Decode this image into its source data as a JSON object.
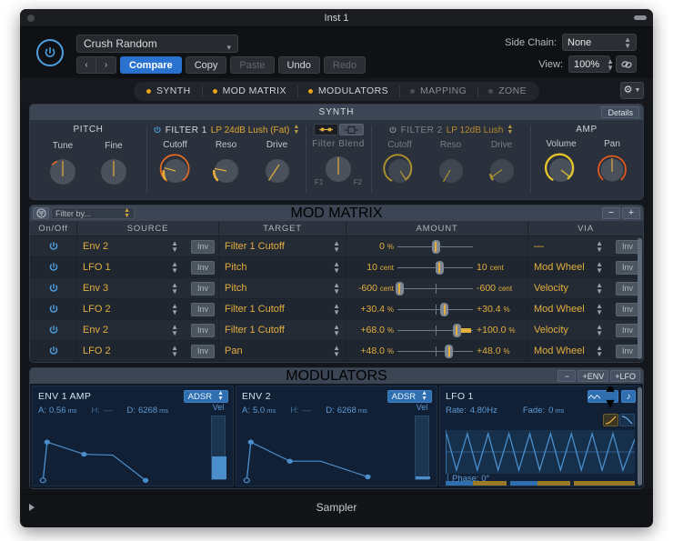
{
  "window": {
    "title": "Inst 1"
  },
  "header": {
    "preset": "Crush Random",
    "prev": "‹",
    "next": "›",
    "compare": "Compare",
    "copy": "Copy",
    "paste": "Paste",
    "undo": "Undo",
    "redo": "Redo",
    "side_chain_label": "Side Chain:",
    "side_chain_value": "None",
    "view_label": "View:",
    "view_value": "100%"
  },
  "tabs": [
    {
      "label": "SYNTH",
      "active": true
    },
    {
      "label": "MOD MATRIX",
      "active": true
    },
    {
      "label": "MODULATORS",
      "active": true
    },
    {
      "label": "MAPPING",
      "active": false
    },
    {
      "label": "ZONE",
      "active": false
    }
  ],
  "synth": {
    "title": "SYNTH",
    "details": "Details",
    "pitch": {
      "label": "PITCH",
      "tune_label": "Tune",
      "fine_label": "Fine"
    },
    "filter1": {
      "label": "FILTER 1",
      "mode": "LP 24dB Lush (Fat)",
      "cutoff_label": "Cutoff",
      "reso_label": "Reso",
      "drive_label": "Drive"
    },
    "blend": {
      "label": "Filter Blend",
      "f1": "F1",
      "f2": "F2"
    },
    "filter2": {
      "label": "FILTER 2",
      "mode": "LP 12dB Lush",
      "cutoff_label": "Cutoff",
      "reso_label": "Reso",
      "drive_label": "Drive"
    },
    "amp": {
      "label": "AMP",
      "volume_label": "Volume",
      "pan_label": "Pan"
    }
  },
  "mod_matrix": {
    "title": "MOD MATRIX",
    "filter_placeholder": "Filter by...",
    "minus": "−",
    "plus": "+",
    "columns": [
      "On/Off",
      "SOURCE",
      "TARGET",
      "AMOUNT",
      "VIA"
    ],
    "inv_label": "Inv",
    "rows": [
      {
        "source": "Env 2",
        "target": "Filter 1 Cutoff",
        "amount_left": "0",
        "unit_left": "%",
        "amount_right": "",
        "unit_right": "",
        "via": "—",
        "thumb_pct": 50,
        "bar": null
      },
      {
        "source": "LFO 1",
        "target": "Pitch",
        "amount_left": "10",
        "unit_left": "cent",
        "amount_right": "10",
        "unit_right": "cent",
        "via": "Mod Wheel",
        "thumb_pct": 55,
        "bar": null
      },
      {
        "source": "Env 3",
        "target": "Pitch",
        "amount_left": "-600",
        "unit_left": "cent",
        "amount_right": "-600",
        "unit_right": "cent",
        "via": "Velocity",
        "thumb_pct": 2,
        "bar": null
      },
      {
        "source": "LFO 2",
        "target": "Filter 1 Cutoff",
        "amount_left": "+30.4",
        "unit_left": "%",
        "amount_right": "+30.4",
        "unit_right": "%",
        "via": "Mod Wheel",
        "thumb_pct": 62,
        "bar": null
      },
      {
        "source": "Env 2",
        "target": "Filter 1 Cutoff",
        "amount_left": "+68.0",
        "unit_left": "%",
        "amount_right": "+100.0",
        "unit_right": "%",
        "via": "Velocity",
        "thumb_pct": 78,
        "bar": {
          "from": 78,
          "to": 98
        }
      },
      {
        "source": "LFO 2",
        "target": "Pan",
        "amount_left": "+48.0",
        "unit_left": "%",
        "amount_right": "+48.0",
        "unit_right": "%",
        "via": "Mod Wheel",
        "thumb_pct": 68,
        "bar": null
      }
    ]
  },
  "modulators": {
    "title": "MODULATORS",
    "minus": "−",
    "add_env": "+ENV",
    "add_lfo": "+LFO",
    "env1": {
      "name": "ENV 1 AMP",
      "type": "ADSR",
      "a_label": "A:",
      "a_value": "0.56",
      "a_unit": "ms",
      "h_label": "H:",
      "h_value": "—",
      "d_label": "D:",
      "d_value": "6268",
      "d_unit": "ms",
      "vel_label": "Vel"
    },
    "env2": {
      "name": "ENV 2",
      "type": "ADSR",
      "a_label": "A:",
      "a_value": "5.0",
      "a_unit": "ms",
      "h_label": "H:",
      "h_value": "—",
      "d_label": "D:",
      "d_value": "6268",
      "d_unit": "ms",
      "vel_label": "Vel"
    },
    "lfo1": {
      "name": "LFO 1",
      "rate_label": "Rate:",
      "rate_value": "4.80Hz",
      "fade_label": "Fade:",
      "fade_value": "0",
      "fade_unit": "ms",
      "phase_label": "Phase:",
      "phase_value": "0°"
    }
  },
  "footer": {
    "plugin_name": "Sampler"
  },
  "colors": {
    "accent_amber": "#e3ae3e",
    "accent_blue": "#2a72cf",
    "filter_orange": "#e06a22",
    "mod_blue": "#4a8ecb"
  }
}
